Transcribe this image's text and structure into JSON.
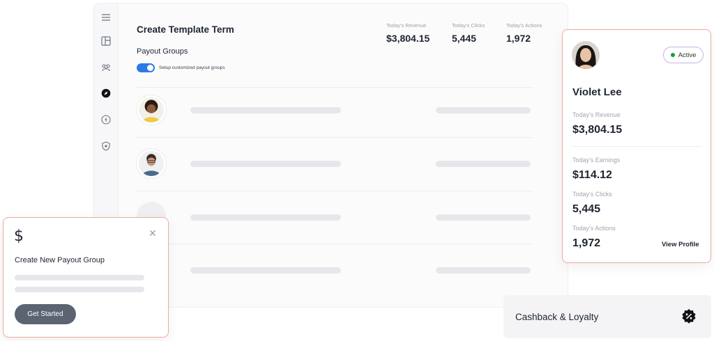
{
  "main": {
    "title": "Create Template Term",
    "subtitle": "Payout Groups",
    "toggle_label": "Setup customized payout groups",
    "stats": [
      {
        "label": "Today's Revenue",
        "value": "$3,804.15"
      },
      {
        "label": "Today's Clicks",
        "value": "5,445"
      },
      {
        "label": "Today's Actions",
        "value": "1,972"
      }
    ]
  },
  "sidebar": {
    "icons": [
      "menu-icon",
      "layout-icon",
      "users-icon",
      "compass-icon",
      "bolt-icon",
      "shield-icon"
    ],
    "active": "compass-icon"
  },
  "profile": {
    "name": "Violet Lee",
    "status": "Active",
    "revenue_label": "Today's Revenue",
    "revenue": "$3,804.15",
    "earnings_label": "Today's Earnings",
    "earnings": "$114.12",
    "clicks_label": "Today's Clicks",
    "clicks": "5,445",
    "actions_label": "Today's Actions",
    "actions": "1,972",
    "view_profile": "View Profile"
  },
  "popup": {
    "icon": "dollar-icon",
    "title": "Create New Payout Group",
    "button": "Get Started"
  },
  "cashback": {
    "label": "Cashback & Loyalty",
    "icon": "discount-badge-icon"
  },
  "colors": {
    "accent_blue": "#2c7be5",
    "card_border": "#f2a7a0",
    "active_green": "#1d9b3e",
    "button": "#5c6472"
  }
}
